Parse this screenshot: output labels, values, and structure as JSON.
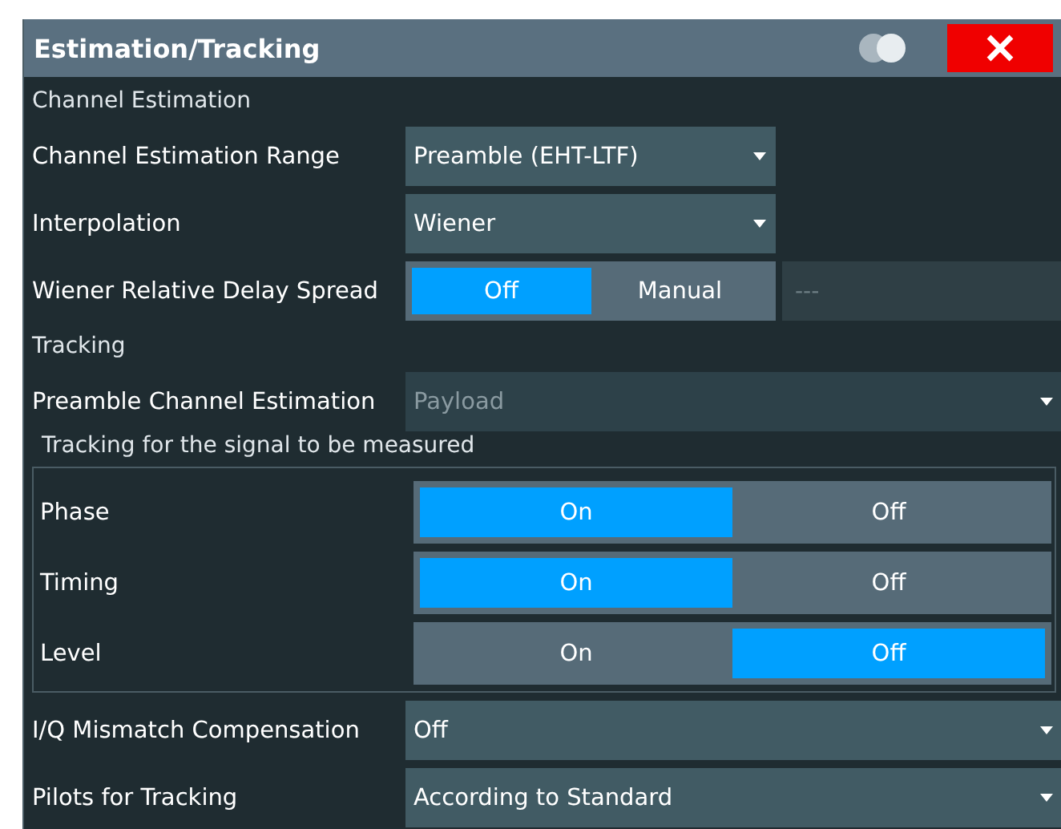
{
  "window": {
    "title": "Estimation/Tracking"
  },
  "items": [
    {
      "kind": "section",
      "label": "Channel Estimation"
    },
    {
      "kind": "dropdown",
      "label": "Channel Estimation Range",
      "value": "Preamble (EHT-LTF)",
      "wide": false,
      "disabled": false
    },
    {
      "kind": "dropdown",
      "label": "Interpolation",
      "value": "Wiener",
      "wide": false,
      "disabled": false
    },
    {
      "kind": "toggle",
      "label": "Wiener Relative Delay Spread",
      "options": [
        {
          "label": "Off",
          "selected": true
        },
        {
          "label": "Manual",
          "selected": false
        }
      ],
      "field": {
        "value": "---",
        "disabled": true
      }
    },
    {
      "kind": "section",
      "label": "Tracking"
    },
    {
      "kind": "dropdown",
      "label": "Preamble Channel Estimation",
      "value": "Payload",
      "wide": true,
      "disabled": true
    },
    {
      "kind": "group",
      "label": "Tracking for the signal to be measured",
      "rows": [
        {
          "label": "Phase",
          "options": [
            {
              "label": "On",
              "selected": true
            },
            {
              "label": "Off",
              "selected": false
            }
          ]
        },
        {
          "label": "Timing",
          "options": [
            {
              "label": "On",
              "selected": true
            },
            {
              "label": "Off",
              "selected": false
            }
          ]
        },
        {
          "label": "Level",
          "options": [
            {
              "label": "On",
              "selected": false
            },
            {
              "label": "Off",
              "selected": true
            }
          ]
        }
      ]
    },
    {
      "kind": "dropdown",
      "label": "I/Q Mismatch Compensation",
      "value": "Off",
      "wide": true,
      "disabled": false
    },
    {
      "kind": "dropdown",
      "label": "Pilots for Tracking",
      "value": "According to Standard",
      "wide": true,
      "disabled": false
    }
  ]
}
